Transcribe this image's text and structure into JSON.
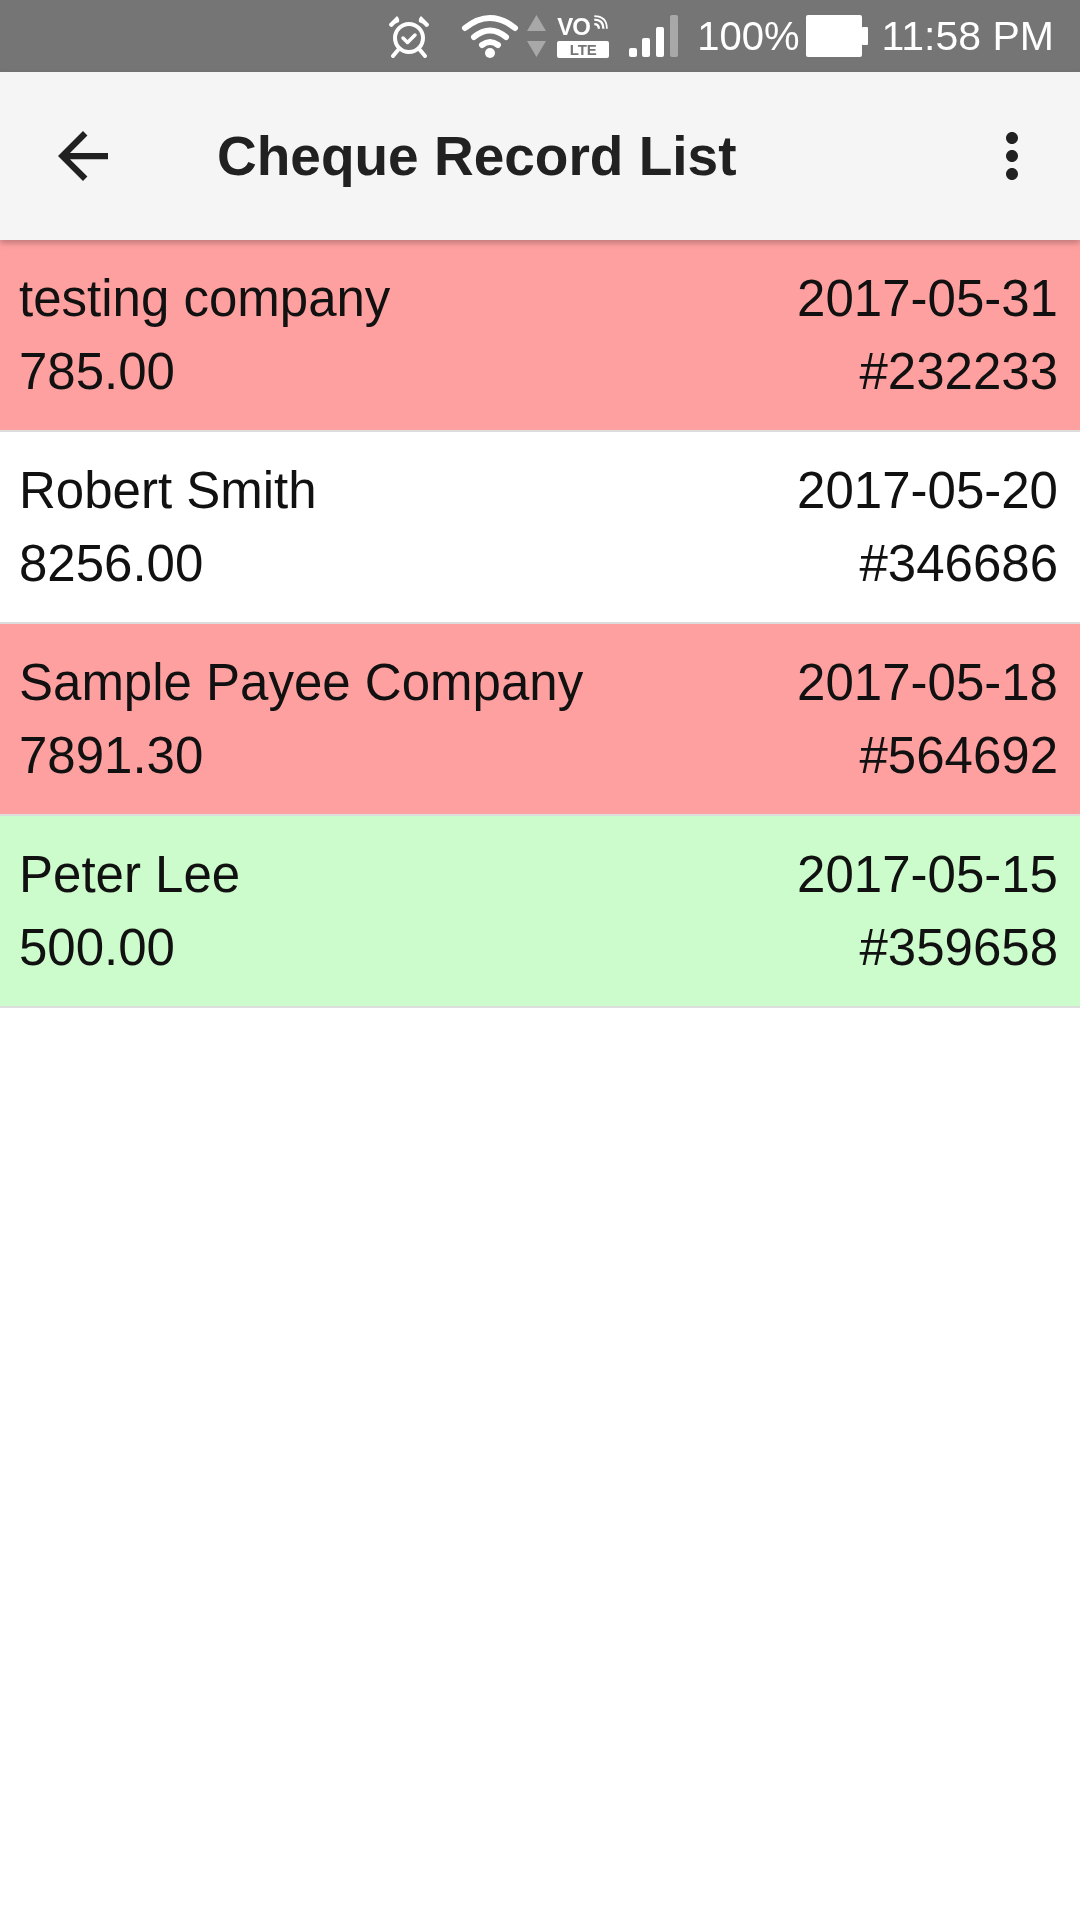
{
  "status_bar": {
    "volte": {
      "top": "VO",
      "bottom": "LTE"
    },
    "battery": "100%",
    "time": "11:58 PM"
  },
  "toolbar": {
    "title": "Cheque Record List"
  },
  "cheques": [
    {
      "payee": "testing company",
      "amount": "785.00",
      "date": "2017-05-31",
      "number": "#232233",
      "color": "#ffa0a0"
    },
    {
      "payee": "Robert Smith",
      "amount": "8256.00",
      "date": "2017-05-20",
      "number": "#346686",
      "color": "#ffffff"
    },
    {
      "payee": "Sample Payee Company",
      "amount": "7891.30",
      "date": "2017-05-18",
      "number": "#564692",
      "color": "#ffa0a0"
    },
    {
      "payee": "Peter Lee",
      "amount": "500.00",
      "date": "2017-05-15",
      "number": "#359658",
      "color": "#ccfccc"
    }
  ]
}
